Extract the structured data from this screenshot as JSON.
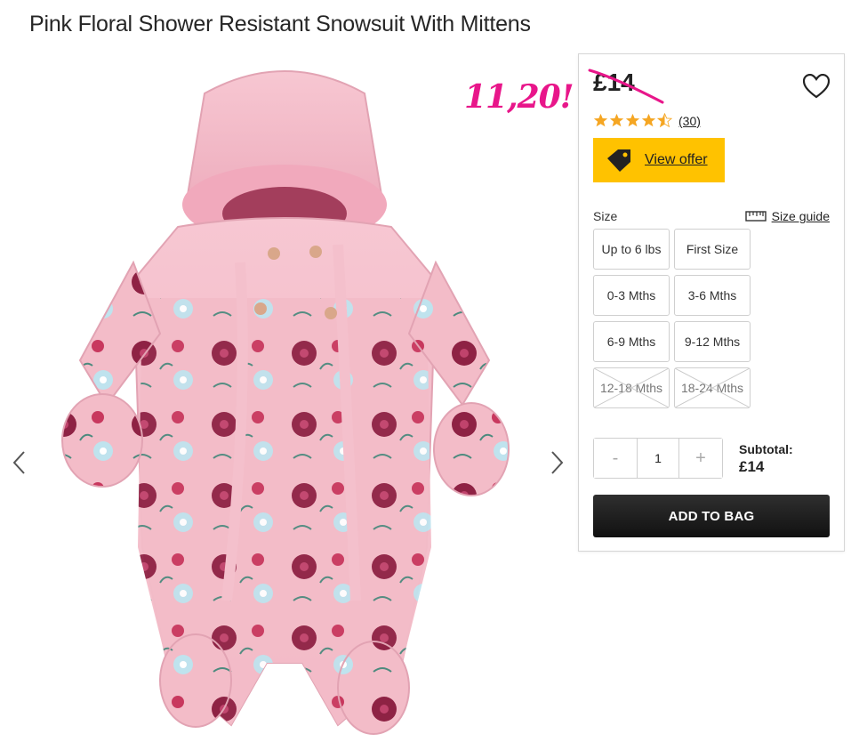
{
  "product": {
    "title": "Pink Floral Shower Resistant Snowsuit With Mittens",
    "price": "£14",
    "annotation": "11,20!",
    "rating": 4.5,
    "review_count": "(30)"
  },
  "offer": {
    "label": "View offer"
  },
  "size": {
    "label": "Size",
    "guide_label": "Size guide",
    "options": [
      {
        "label": "Up to 6 lbs",
        "available": true
      },
      {
        "label": "First Size",
        "available": true
      },
      {
        "label": "0-3 Mths",
        "available": true
      },
      {
        "label": "3-6 Mths",
        "available": true
      },
      {
        "label": "6-9 Mths",
        "available": true
      },
      {
        "label": "9-12 Mths",
        "available": true
      },
      {
        "label": "12-18 Mths",
        "available": false
      },
      {
        "label": "18-24 Mths",
        "available": false
      }
    ]
  },
  "quantity": {
    "minus": "-",
    "value": "1",
    "plus": "+"
  },
  "subtotal": {
    "label": "Subtotal:",
    "value": "£14"
  },
  "cart": {
    "add_label": "ADD TO BAG"
  },
  "colors": {
    "accent_yellow": "#ffc200",
    "annotation_pink": "#e8168a",
    "star": "#f5a623",
    "suit_pink": "#f2b6c3",
    "flower_dark": "#8e2244",
    "flower_light": "#bfe3ee"
  },
  "icons": {
    "prev": "chevron-left-icon",
    "next": "chevron-right-icon",
    "wishlist": "heart-icon",
    "offer": "price-tag-icon",
    "size_guide": "ruler-icon"
  }
}
